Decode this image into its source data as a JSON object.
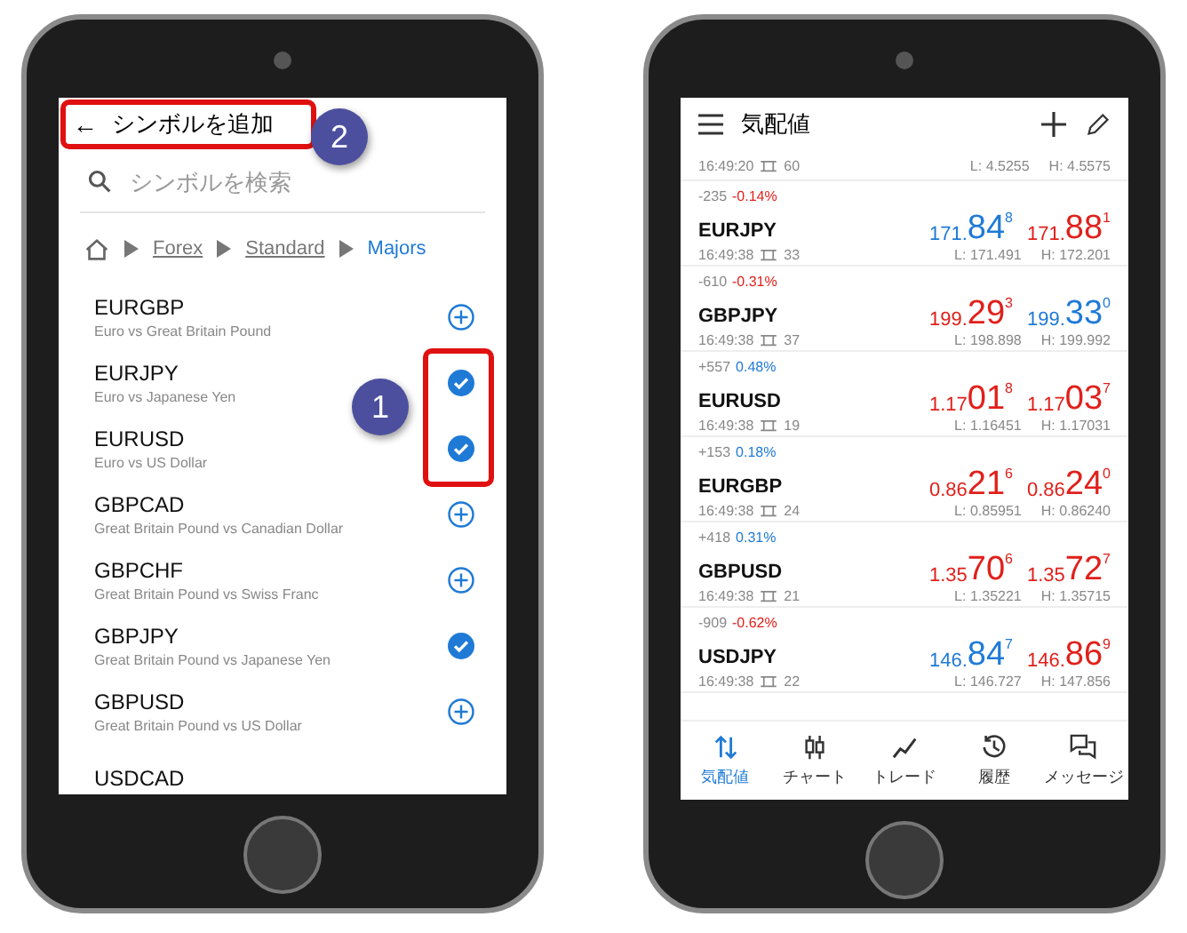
{
  "symbol_screen": {
    "header": {
      "back_icon": "←",
      "title": "シンボルを追加"
    },
    "search": {
      "placeholder": "シンボルを検索"
    },
    "breadcrumb": [
      {
        "label": "Forex",
        "selected": false
      },
      {
        "label": "Standard",
        "selected": false
      },
      {
        "label": "Majors",
        "selected": true
      }
    ],
    "symbols": [
      {
        "name": "EURGBP",
        "description": "Euro vs Great Britain Pound",
        "checked": false
      },
      {
        "name": "EURJPY",
        "description": "Euro vs Japanese Yen",
        "checked": true
      },
      {
        "name": "EURUSD",
        "description": "Euro vs US Dollar",
        "checked": true
      },
      {
        "name": "GBPCAD",
        "description": "Great Britain Pound vs Canadian Dollar",
        "checked": false
      },
      {
        "name": "GBPCHF",
        "description": "Great Britain Pound vs Swiss Franc",
        "checked": false
      },
      {
        "name": "GBPJPY",
        "description": "Great Britain Pound vs Japanese Yen",
        "checked": true
      },
      {
        "name": "GBPUSD",
        "description": "Great Britain Pound vs US Dollar",
        "checked": false
      },
      {
        "name": "USDCAD"
      }
    ]
  },
  "annotations": [
    {
      "label": "2"
    },
    {
      "label": "1"
    }
  ],
  "quotes_screen": {
    "header": {
      "title": "気配値"
    },
    "partial_row": {
      "time": "16:49:20",
      "spread": "60",
      "low": "L: 4.5255",
      "high": "H: 4.5575"
    },
    "quotes": [
      {
        "change": "-235",
        "percent": {
          "text": "-0.14%",
          "color": "#e0201b"
        },
        "symbol": "EURJPY",
        "time": "16:49:38",
        "spread": "33",
        "bid": {
          "head": "171.",
          "big": "84",
          "sup": "8",
          "color": "#1f7ad6"
        },
        "ask": {
          "head": "171.",
          "big": "88",
          "sup": "1",
          "color": "#e0201b"
        },
        "low": "L: 171.491",
        "high": "H: 172.201"
      },
      {
        "change": "-610",
        "percent": {
          "text": "-0.31%",
          "color": "#e0201b"
        },
        "symbol": "GBPJPY",
        "time": "16:49:38",
        "spread": "37",
        "bid": {
          "head": "199.",
          "big": "29",
          "sup": "3",
          "color": "#e0201b"
        },
        "ask": {
          "head": "199.",
          "big": "33",
          "sup": "0",
          "color": "#1f7ad6"
        },
        "low": "L: 198.898",
        "high": "H: 199.992"
      },
      {
        "change": "+557",
        "percent": {
          "text": "0.48%",
          "color": "#1f7ad6"
        },
        "symbol": "EURUSD",
        "time": "16:49:38",
        "spread": "19",
        "bid": {
          "head": "1.17",
          "big": "01",
          "sup": "8",
          "color": "#e0201b"
        },
        "ask": {
          "head": "1.17",
          "big": "03",
          "sup": "7",
          "color": "#e0201b"
        },
        "low": "L: 1.16451",
        "high": "H: 1.17031"
      },
      {
        "change": "+153",
        "percent": {
          "text": "0.18%",
          "color": "#1f7ad6"
        },
        "symbol": "EURGBP",
        "time": "16:49:38",
        "spread": "24",
        "bid": {
          "head": "0.86",
          "big": "21",
          "sup": "6",
          "color": "#e0201b"
        },
        "ask": {
          "head": "0.86",
          "big": "24",
          "sup": "0",
          "color": "#e0201b"
        },
        "low": "L: 0.85951",
        "high": "H: 0.86240"
      },
      {
        "change": "+418",
        "percent": {
          "text": "0.31%",
          "color": "#1f7ad6"
        },
        "symbol": "GBPUSD",
        "time": "16:49:38",
        "spread": "21",
        "bid": {
          "head": "1.35",
          "big": "70",
          "sup": "6",
          "color": "#e0201b"
        },
        "ask": {
          "head": "1.35",
          "big": "72",
          "sup": "7",
          "color": "#e0201b"
        },
        "low": "L: 1.35221",
        "high": "H: 1.35715"
      },
      {
        "change": "-909",
        "percent": {
          "text": "-0.62%",
          "color": "#e0201b"
        },
        "symbol": "USDJPY",
        "time": "16:49:38",
        "spread": "22",
        "bid": {
          "head": "146.",
          "big": "84",
          "sup": "7",
          "color": "#1f7ad6"
        },
        "ask": {
          "head": "146.",
          "big": "86",
          "sup": "9",
          "color": "#e0201b"
        },
        "low": "L: 146.727",
        "high": "H: 147.856"
      }
    ],
    "nav": [
      {
        "kind": "quotes",
        "label": "気配値",
        "selected": true
      },
      {
        "kind": "chart",
        "label": "チャート",
        "selected": false
      },
      {
        "kind": "trade",
        "label": "トレード",
        "selected": false
      },
      {
        "kind": "history",
        "label": "履歴",
        "selected": false
      },
      {
        "kind": "messages",
        "label": "メッセージ",
        "selected": false
      }
    ]
  }
}
